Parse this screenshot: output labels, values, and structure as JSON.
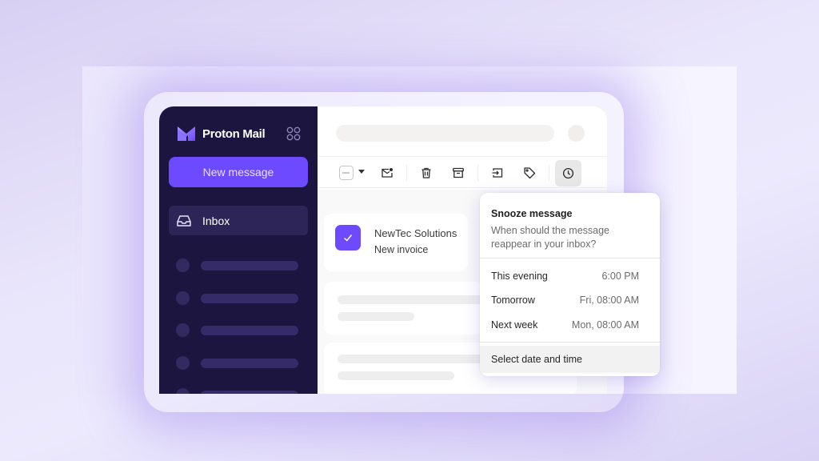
{
  "app": {
    "brand_name": "Proton Mail",
    "accent_color": "#6d4aff",
    "sidebar_color": "#1c1540"
  },
  "sidebar": {
    "new_message_label": "New message",
    "items": [
      {
        "label": "Inbox",
        "icon": "inbox-icon",
        "active": true
      }
    ],
    "placeholder_rows": 5
  },
  "toolbar": {
    "buttons": [
      {
        "name": "select-all-checkbox",
        "icon": "checkbox-indeterminate-icon"
      },
      {
        "name": "select-dropdown",
        "icon": "caret-down-icon"
      },
      {
        "name": "mark-unread",
        "icon": "envelope-dot-icon"
      },
      {
        "name": "delete",
        "icon": "trash-icon"
      },
      {
        "name": "archive",
        "icon": "archive-icon"
      },
      {
        "name": "move-to",
        "icon": "move-folder-icon"
      },
      {
        "name": "label",
        "icon": "tag-icon"
      },
      {
        "name": "snooze",
        "icon": "clock-icon",
        "active": true
      }
    ]
  },
  "messages": [
    {
      "sender": "NewTec Solutions",
      "subject": "New invoice",
      "selected": true
    }
  ],
  "snooze_popover": {
    "title": "Snooze message",
    "description": "When should the message reappear in your inbox?",
    "options": [
      {
        "label": "This evening",
        "value": "6:00 PM"
      },
      {
        "label": "Tomorrow",
        "value": "Fri, 08:00 AM"
      },
      {
        "label": "Next week",
        "value": "Mon, 08:00 AM"
      }
    ],
    "custom_label": "Select date and time"
  }
}
